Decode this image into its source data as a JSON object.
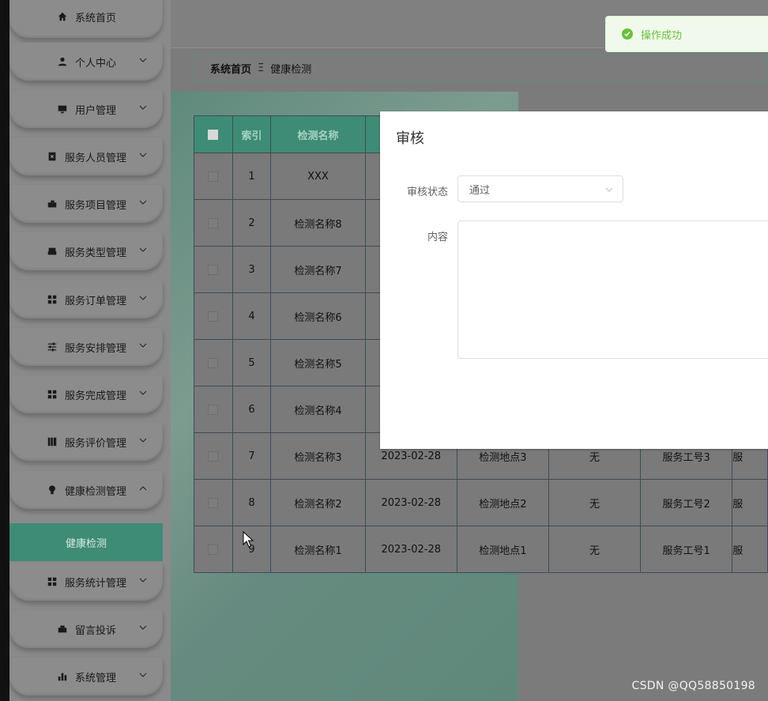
{
  "sidebar": {
    "items": [
      {
        "label": "系统首页",
        "icon": "home-icon"
      },
      {
        "label": "个人中心",
        "icon": "user-icon"
      },
      {
        "label": "用户管理",
        "icon": "monitor-icon"
      },
      {
        "label": "服务人员管理",
        "icon": "clipboard-icon"
      },
      {
        "label": "服务项目管理",
        "icon": "briefcase-icon"
      },
      {
        "label": "服务类型管理",
        "icon": "printer-icon"
      },
      {
        "label": "服务订单管理",
        "icon": "grid-icon"
      },
      {
        "label": "服务安排管理",
        "icon": "sliders-icon"
      },
      {
        "label": "服务完成管理",
        "icon": "grid-icon"
      },
      {
        "label": "服务评价管理",
        "icon": "book-icon"
      },
      {
        "label": "健康检测管理",
        "icon": "bulb-icon"
      },
      {
        "label": "服务统计管理",
        "icon": "grid-icon"
      },
      {
        "label": "留言投诉",
        "icon": "toolbox-icon"
      },
      {
        "label": "系统管理",
        "icon": "bar-chart-icon"
      }
    ],
    "active_sub": "健康检测"
  },
  "breadcrumb": {
    "home": "系统首页",
    "separator": "Ξ",
    "current": "健康检测"
  },
  "toast": {
    "message": "操作成功",
    "color": "#67c23a"
  },
  "table": {
    "headers": [
      "",
      "索引",
      "检测名称"
    ],
    "rows": [
      {
        "index": "1",
        "name": "XXX",
        "date": "",
        "place": "",
        "note": "",
        "worker": "",
        "more": ""
      },
      {
        "index": "2",
        "name": "检测名称8",
        "date": "",
        "place": "",
        "note": "",
        "worker": "",
        "more": ""
      },
      {
        "index": "3",
        "name": "检测名称7",
        "date": "",
        "place": "",
        "note": "",
        "worker": "",
        "more": ""
      },
      {
        "index": "4",
        "name": "检测名称6",
        "date": "",
        "place": "",
        "note": "",
        "worker": "",
        "more": ""
      },
      {
        "index": "5",
        "name": "检测名称5",
        "date": "",
        "place": "",
        "note": "",
        "worker": "",
        "more": ""
      },
      {
        "index": "6",
        "name": "检测名称4",
        "date": "",
        "place": "",
        "note": "",
        "worker": "",
        "more": ""
      },
      {
        "index": "7",
        "name": "检测名称3",
        "date": "2023-02-28",
        "place": "检测地点3",
        "note": "无",
        "worker": "服务工号3",
        "more": "服"
      },
      {
        "index": "8",
        "name": "检测名称2",
        "date": "2023-02-28",
        "place": "检测地点2",
        "note": "无",
        "worker": "服务工号2",
        "more": "服"
      },
      {
        "index": "9",
        "name": "检测名称1",
        "date": "2023-02-28",
        "place": "检测地点1",
        "note": "无",
        "worker": "服务工号1",
        "more": "服"
      }
    ]
  },
  "dialog": {
    "title": "审核",
    "status_label": "审核状态",
    "status_value": "通过",
    "content_label": "内容",
    "content_value": ""
  },
  "watermark": "CSDN @QQ58850198",
  "colors": {
    "accent": "#3e8c75",
    "overlay": "#7b7b7b"
  }
}
